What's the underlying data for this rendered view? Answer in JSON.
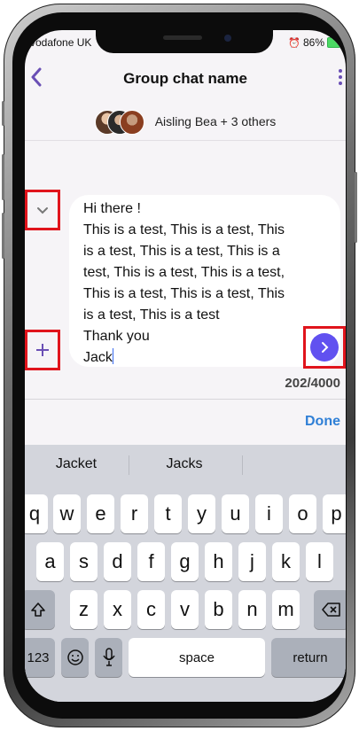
{
  "status_bar": {
    "carrier": "vodafone UK",
    "battery": "86%",
    "accent": "#4cd964"
  },
  "header": {
    "back_icon": "chevron-left-icon",
    "title": "Group chat name",
    "more_icon": "more-vertical-icon"
  },
  "members": {
    "text": "Aisling Bea + 3 others",
    "avatar_count": 3
  },
  "composer": {
    "lines": [
      "Hi there !",
      "This is a test, This is a test, This",
      "is a test, This is a test, This is a",
      "test, This is a test, This is a test,",
      "This is a test, This is a test, This",
      "is a test, This is a test",
      "Thank you"
    ],
    "last_line": "Jack",
    "collapse_icon": "chevron-down-icon",
    "add_icon": "plus-icon",
    "send_icon": "send-arrow-icon",
    "counter": "202/4000"
  },
  "toolbar": {
    "done_label": "Done"
  },
  "keyboard": {
    "suggestions": [
      "Jacket",
      "Jacks"
    ],
    "row1": [
      "q",
      "w",
      "e",
      "r",
      "t",
      "y",
      "u",
      "i",
      "o",
      "p"
    ],
    "row2": [
      "a",
      "s",
      "d",
      "f",
      "g",
      "h",
      "j",
      "k",
      "l"
    ],
    "row3": [
      "z",
      "x",
      "c",
      "v",
      "b",
      "n",
      "m"
    ],
    "numbers_label": "123",
    "space_label": "space",
    "return_label": "return",
    "shift_icon": "shift-icon",
    "delete_icon": "backspace-icon",
    "emoji_icon": "emoji-icon",
    "mic_icon": "microphone-icon"
  },
  "colors": {
    "brand": "#6a4fb5",
    "send": "#6151f0",
    "highlight": "#e0141c",
    "done": "#2f7fd6"
  }
}
